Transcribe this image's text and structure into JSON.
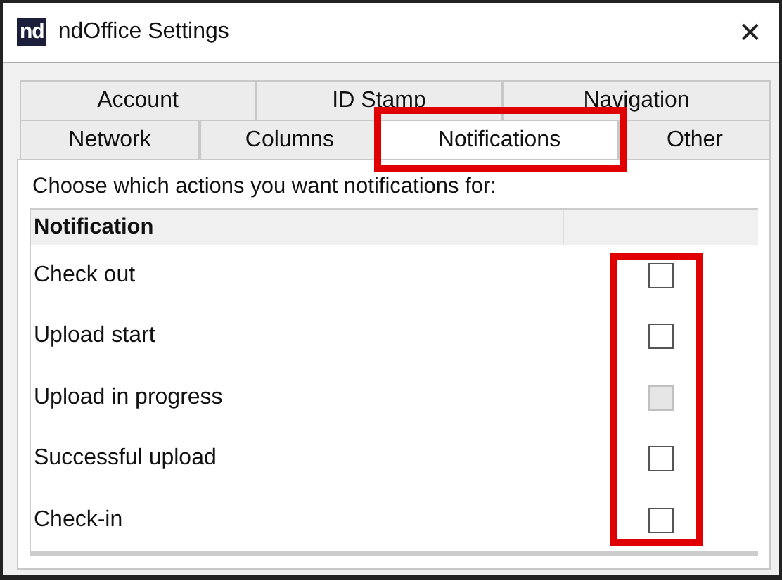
{
  "window": {
    "title": "ndOffice Settings",
    "logo": "nd",
    "close": "✕"
  },
  "tab_rows": [
    [
      {
        "label": "Account",
        "selected": false,
        "highlighted": false
      },
      {
        "label": "ID Stamp",
        "selected": false,
        "highlighted": false
      },
      {
        "label": "Navigation",
        "selected": false,
        "highlighted": false
      }
    ],
    [
      {
        "label": "Network",
        "selected": false,
        "highlighted": false
      },
      {
        "label": "Columns",
        "selected": false,
        "highlighted": false
      },
      {
        "label": "Notifications",
        "selected": true,
        "highlighted": true
      },
      {
        "label": "Other",
        "selected": false,
        "highlighted": false
      }
    ]
  ],
  "description": "Choose which actions you want notifications for:",
  "table": {
    "columns": [
      "Notification"
    ],
    "checkbox_column_highlighted": true,
    "rows": [
      {
        "label": "Check out",
        "checked": false,
        "disabled": false
      },
      {
        "label": "Upload start",
        "checked": false,
        "disabled": false
      },
      {
        "label": "Upload in progress",
        "checked": false,
        "disabled": true
      },
      {
        "label": "Successful upload",
        "checked": false,
        "disabled": false
      },
      {
        "label": "Check-in",
        "checked": false,
        "disabled": false
      }
    ]
  }
}
